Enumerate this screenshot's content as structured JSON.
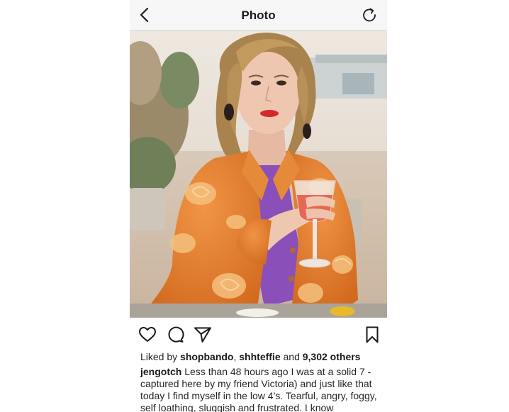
{
  "header": {
    "title": "Photo",
    "back_icon": "chevron-left-icon",
    "refresh_icon": "refresh-icon"
  },
  "post": {
    "image_alt": "Woman with wavy blonde hair in an orange brocade jacket holding a glass of rosé",
    "actions": {
      "like_icon": "heart-icon",
      "comment_icon": "comment-icon",
      "share_icon": "paper-plane-icon",
      "save_icon": "bookmark-icon"
    },
    "likes": {
      "prefix": "Liked by ",
      "user1": "shopbando",
      "separator": ", ",
      "user2": "shhteffie",
      "connector": " and ",
      "others": "9,302 others"
    },
    "caption": {
      "username": "jengotch",
      "text": " Less than 48 hours ago I was at a solid 7 - captured here by my friend Victoria) and just like that today I find myself in the low 4’s. Tearful, angry, foggy, self loathing, sluggish and frustrated.  I know"
    }
  },
  "colors": {
    "text": "#262626",
    "topbar_bg": "#f7f7f7",
    "jacket_orange": "#e5812e"
  }
}
